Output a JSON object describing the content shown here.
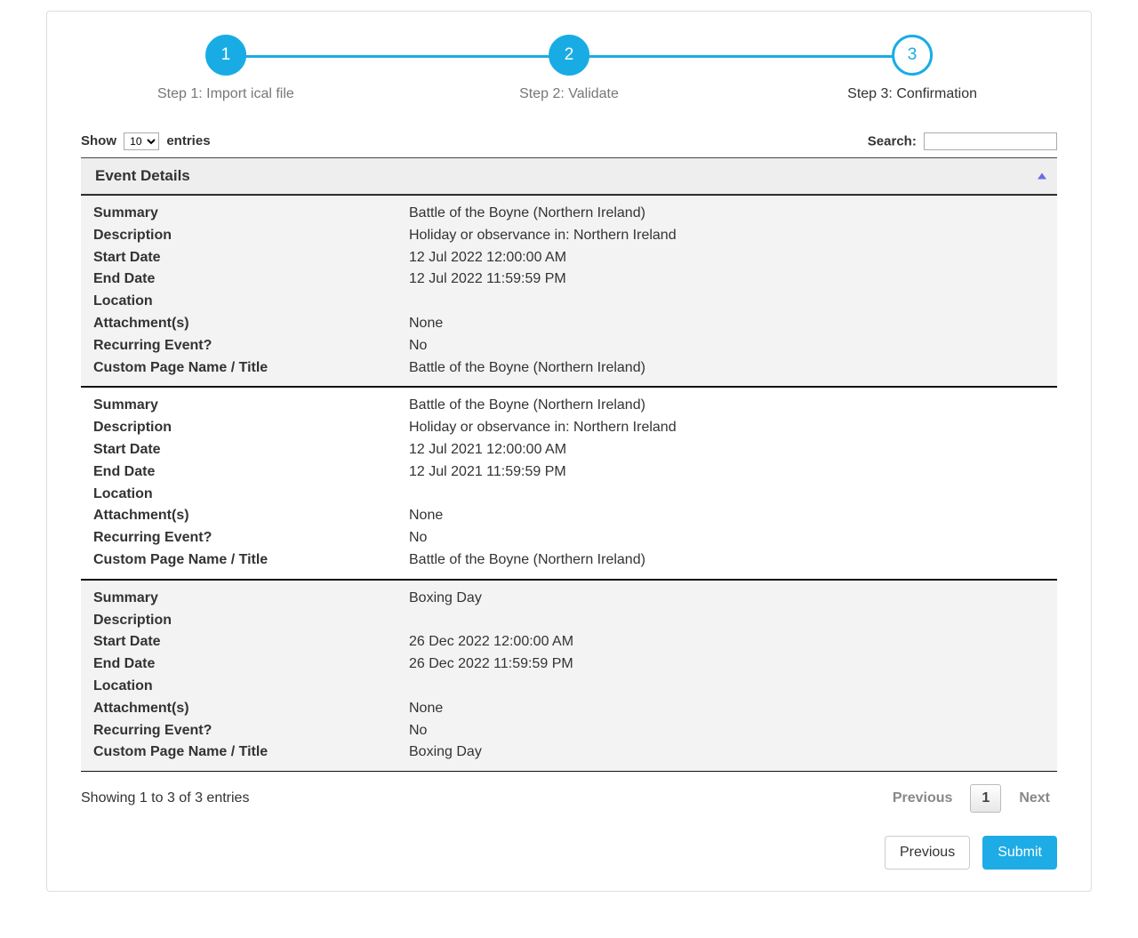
{
  "stepper": {
    "steps": [
      {
        "num": "1",
        "label": "Step 1: Import ical file",
        "state": "done"
      },
      {
        "num": "2",
        "label": "Step 2: Validate",
        "state": "done"
      },
      {
        "num": "3",
        "label": "Step 3: Confirmation",
        "state": "current"
      }
    ]
  },
  "datatable": {
    "length_prefix": "Show",
    "length_suffix": "entries",
    "length_value": "10",
    "search_label": "Search:",
    "search_value": "",
    "header": "Event Details",
    "info": "Showing 1 to 3 of 3 entries",
    "paginate": {
      "previous": "Previous",
      "next": "Next",
      "current_page": "1"
    }
  },
  "fields": {
    "summary": "Summary",
    "description": "Description",
    "start_date": "Start Date",
    "end_date": "End Date",
    "location": "Location",
    "attachments": "Attachment(s)",
    "recurring": "Recurring Event?",
    "custom_title": "Custom Page Name / Title"
  },
  "events": [
    {
      "summary": "Battle of the Boyne (Northern Ireland)",
      "description": "Holiday or observance in: Northern Ireland",
      "start_date": "12 Jul 2022 12:00:00 AM",
      "end_date": "12 Jul 2022 11:59:59 PM",
      "location": "",
      "attachments": "None",
      "recurring": "No",
      "custom_title": "Battle of the Boyne (Northern Ireland)"
    },
    {
      "summary": "Battle of the Boyne (Northern Ireland)",
      "description": "Holiday or observance in: Northern Ireland",
      "start_date": "12 Jul 2021 12:00:00 AM",
      "end_date": "12 Jul 2021 11:59:59 PM",
      "location": "",
      "attachments": "None",
      "recurring": "No",
      "custom_title": "Battle of the Boyne (Northern Ireland)"
    },
    {
      "summary": "Boxing Day",
      "description": "",
      "start_date": "26 Dec 2022 12:00:00 AM",
      "end_date": "26 Dec 2022 11:59:59 PM",
      "location": "",
      "attachments": "None",
      "recurring": "No",
      "custom_title": "Boxing Day"
    }
  ],
  "wizard_buttons": {
    "previous": "Previous",
    "submit": "Submit"
  }
}
